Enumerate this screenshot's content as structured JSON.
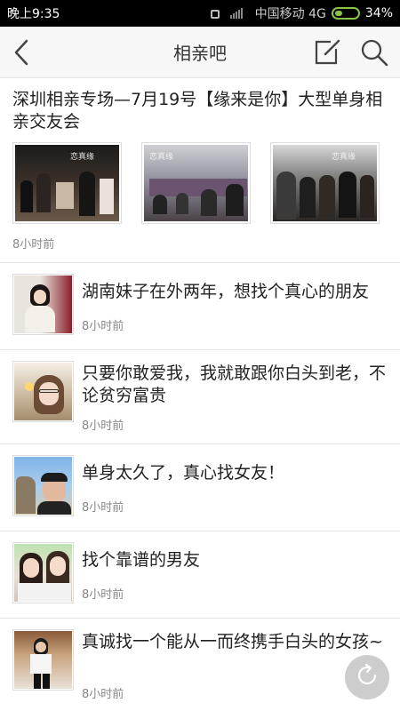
{
  "status_bar": {
    "time": "晚上9:35",
    "carrier": "中国移动 4G",
    "battery": "34%",
    "battery_color": "#8BC34A"
  },
  "nav": {
    "title": "相亲吧",
    "back_icon": "back-chevron-icon",
    "edit_icon": "compose-icon",
    "search_icon": "search-icon"
  },
  "featured_post": {
    "title": "深圳相亲专场—7月19号【缘来是你】大型单身相亲交友会",
    "photo_caption": "恋真缘",
    "time": "8小时前"
  },
  "posts": [
    {
      "title": "湖南妹子在外两年，想找个真心的朋友",
      "time": "8小时前"
    },
    {
      "title": "只要你敢爱我，我就敢跟你白头到老，不论贫穷富贵",
      "time": "8小时前"
    },
    {
      "title": "单身太久了，真心找女友！",
      "time": "8小时前"
    },
    {
      "title": "找个靠谱的男友",
      "time": "8小时前"
    },
    {
      "title": "真诚找一个能从一而终携手白头的女孩~",
      "time": "8小时前"
    }
  ],
  "refresh_icon": "refresh-icon"
}
